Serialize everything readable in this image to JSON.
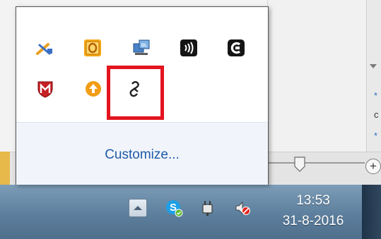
{
  "flyout": {
    "customize_label": "Customize...",
    "icons_row1": [
      "bluetooth-pen-icon",
      "office-orange-icon",
      "network-dl-icon",
      "wireless-audio-icon",
      "creative-c-icon"
    ],
    "icons_row2": [
      "mcafee-shield-icon",
      "update-arrow-icon",
      "link-app-icon"
    ],
    "highlight_color": "#e3141e"
  },
  "taskbar": {
    "time": "13:53",
    "date": "31-8-2016",
    "tray_icons": [
      "show-hidden-icons-icon",
      "skype-icon",
      "power-plug-icon",
      "volume-muted-icon"
    ]
  },
  "background": {
    "zoom_plus_label": "+",
    "side_marks": [
      "*",
      "c",
      "*"
    ]
  },
  "colors": {
    "taskbar": "#5c7f9d",
    "link": "#1e5ba8",
    "highlight": "#e3141e"
  }
}
